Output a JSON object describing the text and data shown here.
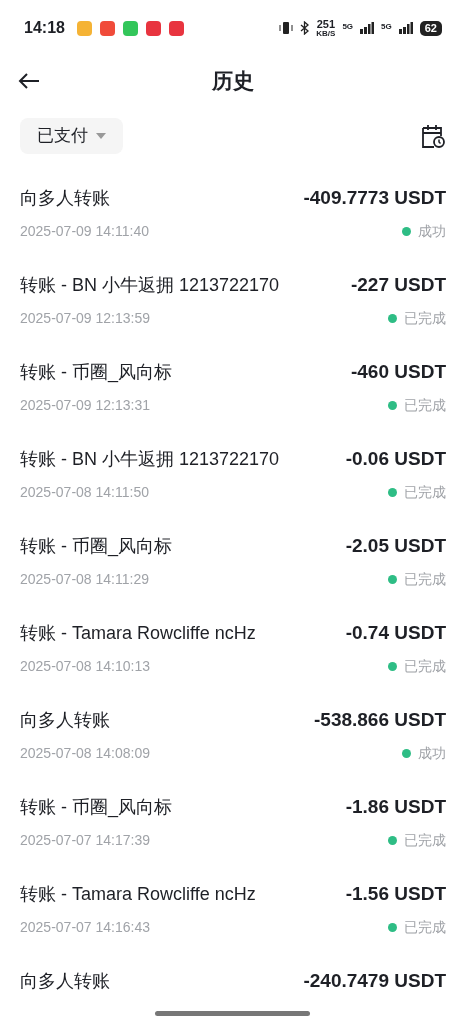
{
  "status_bar": {
    "time": "14:18",
    "speed": "251",
    "speed_unit": "KB/S",
    "network_1": "5G",
    "network_2": "5G",
    "battery": "62"
  },
  "header": {
    "title": "历史"
  },
  "filter": {
    "label": "已支付"
  },
  "transactions": [
    {
      "title": "向多人转账",
      "amount": "-409.7773 USDT",
      "date": "2025-07-09 14:11:40",
      "status": "成功"
    },
    {
      "title": "转账 - BN 小牛返拥 1213722170",
      "amount": "-227 USDT",
      "date": "2025-07-09 12:13:59",
      "status": "已完成"
    },
    {
      "title": "转账 - 币圈_风向标",
      "amount": "-460 USDT",
      "date": "2025-07-09 12:13:31",
      "status": "已完成"
    },
    {
      "title": "转账 - BN 小牛返拥 1213722170",
      "amount": "-0.06 USDT",
      "date": "2025-07-08 14:11:50",
      "status": "已完成"
    },
    {
      "title": "转账 - 币圈_风向标",
      "amount": "-2.05 USDT",
      "date": "2025-07-08 14:11:29",
      "status": "已完成"
    },
    {
      "title": "转账 - Tamara Rowcliffe ncHz",
      "amount": "-0.74 USDT",
      "date": "2025-07-08 14:10:13",
      "status": "已完成"
    },
    {
      "title": "向多人转账",
      "amount": "-538.866 USDT",
      "date": "2025-07-08 14:08:09",
      "status": "成功"
    },
    {
      "title": "转账 - 币圈_风向标",
      "amount": "-1.86 USDT",
      "date": "2025-07-07 14:17:39",
      "status": "已完成"
    },
    {
      "title": "转账 - Tamara Rowcliffe ncHz",
      "amount": "-1.56 USDT",
      "date": "2025-07-07 14:16:43",
      "status": "已完成"
    },
    {
      "title": "向多人转账",
      "amount": "-240.7479 USDT"
    }
  ]
}
